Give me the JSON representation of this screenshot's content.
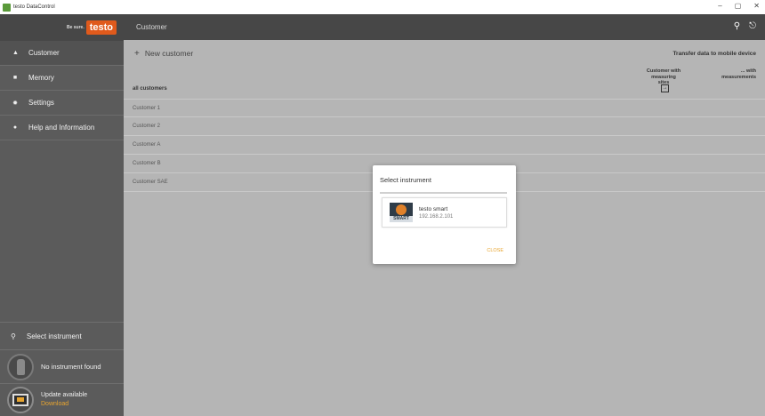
{
  "window": {
    "title": "testo DataControl",
    "controls": {
      "minimize": "–",
      "maximize": "▢",
      "close": "✕"
    }
  },
  "sidebar": {
    "brand_slogan": "Be sure.",
    "brand_logo": "testo",
    "items": [
      {
        "label": "Customer",
        "icon": "person-icon"
      },
      {
        "label": "Memory",
        "icon": "database-icon"
      },
      {
        "label": "Settings",
        "icon": "gear-icon"
      },
      {
        "label": "Help and Information",
        "icon": "help-icon"
      }
    ],
    "select_instrument": "Select instrument",
    "no_instrument": "No instrument found",
    "update_title": "Update available",
    "update_link": "Download"
  },
  "header": {
    "title": "Customer"
  },
  "toolbar": {
    "new_customer": "New customer",
    "transfer_title": "Transfer data to mobile device",
    "col_a_line1": "Customer with",
    "col_a_line2": "measuring sites",
    "col_b_line1": "... with",
    "col_b_line2": "measurements"
  },
  "list": {
    "header": "all customers",
    "rows": [
      "Customer 1",
      "Customer 2",
      "Customer A",
      "Customer B",
      "Customer SAE"
    ]
  },
  "dialog": {
    "title": "Select instrument",
    "instrument_name": "testo smart",
    "instrument_ip": "192.168.2.101",
    "instrument_badge": "SMART",
    "close_label": "CLOSE"
  },
  "colors": {
    "accent": "#e8a530",
    "brand": "#e05a1c",
    "sidebar": "#5b5b5b",
    "header": "#474747"
  }
}
